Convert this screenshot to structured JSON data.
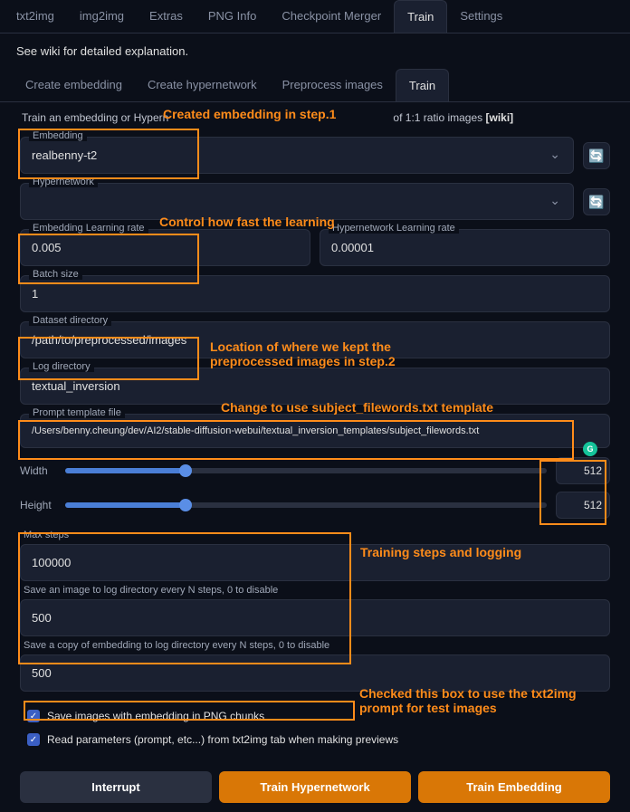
{
  "topTabs": [
    "txt2img",
    "img2img",
    "Extras",
    "PNG Info",
    "Checkpoint Merger",
    "Train",
    "Settings"
  ],
  "activeTopTab": 5,
  "wikiText": "See wiki for detailed explanation.",
  "subTabs": [
    "Create embedding",
    "Create hypernetwork",
    "Preprocess images",
    "Train"
  ],
  "activeSubTab": 3,
  "description": {
    "prefix": "Train an embedding or Hypern",
    "suffix": "of 1:1 ratio images ",
    "link": "[wiki]"
  },
  "fields": {
    "embedding": {
      "label": "Embedding",
      "value": "realbenny-t2"
    },
    "hypernetwork": {
      "label": "Hypernetwork",
      "value": ""
    },
    "embLearningRate": {
      "label": "Embedding Learning rate",
      "value": "0.005"
    },
    "hyperLearningRate": {
      "label": "Hypernetwork Learning rate",
      "value": "0.00001"
    },
    "batchSize": {
      "label": "Batch size",
      "value": "1"
    },
    "datasetDir": {
      "label": "Dataset directory",
      "value": "/path/to/preprocessed/images"
    },
    "logDir": {
      "label": "Log directory",
      "value": "textual_inversion"
    },
    "promptTemplate": {
      "label": "Prompt template file",
      "value": "/Users/benny.cheung/dev/AI2/stable-diffusion-webui/textual_inversion_templates/subject_filewords.txt"
    },
    "width": {
      "label": "Width",
      "value": "512"
    },
    "height": {
      "label": "Height",
      "value": "512"
    },
    "maxSteps": {
      "label": "Max steps",
      "value": "100000"
    },
    "saveImage": {
      "label": "Save an image to log directory every N steps, 0 to disable",
      "value": "500"
    },
    "saveCopy": {
      "label": "Save a copy of embedding to log directory every N steps, 0 to disable",
      "value": "500"
    }
  },
  "checkboxes": {
    "savePng": "Save images with embedding in PNG chunks",
    "readParams": "Read parameters (prompt, etc...) from txt2img tab when making previews"
  },
  "buttons": {
    "interrupt": "Interrupt",
    "trainHyper": "Train Hypernetwork",
    "trainEmb": "Train Embedding"
  },
  "annotations": {
    "step1": "Created embedding in step.1",
    "learning": "Control how fast the learning",
    "location": "Location of where we kept the preprocessed images in step.2",
    "template": "Change to use subject_filewords.txt template",
    "steps": "Training steps and logging",
    "checked": "Checked this box to use the txt2img prompt for test images"
  }
}
